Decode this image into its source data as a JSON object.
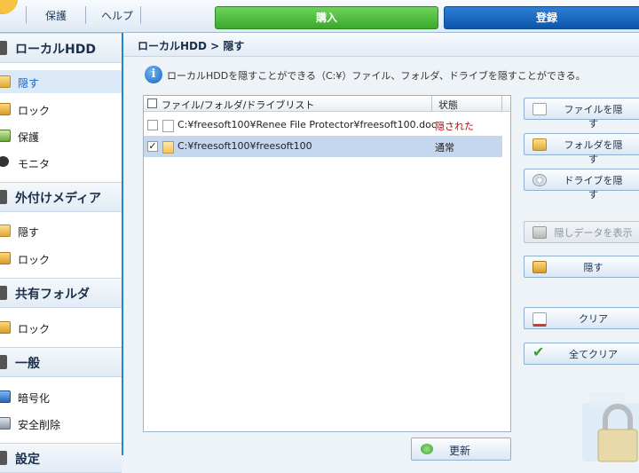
{
  "topbar": {
    "protect_label": "保護",
    "help_label": "ヘルプ",
    "buy_label": "購入",
    "register_label": "登録"
  },
  "sidebar": {
    "sections": [
      {
        "title": "ローカルHDD",
        "items": [
          "隠す",
          "ロック",
          "保護",
          "モニタ"
        ]
      },
      {
        "title": "外付けメディア",
        "items": [
          "隠す",
          "ロック"
        ]
      },
      {
        "title": "共有フォルダ",
        "items": [
          "ロック"
        ]
      },
      {
        "title": "一般",
        "items": [
          "暗号化",
          "安全削除"
        ]
      },
      {
        "title": "設定",
        "items": []
      }
    ]
  },
  "breadcrumb": "ローカルHDD > 隠す",
  "info_text": "ローカルHDDを隠すことができる（C:¥）ファイル、フォルダ、ドライブを隠すことができる。",
  "list": {
    "col_name": "ファイル/フォルダ/ドライブリスト",
    "col_status": "状態",
    "rows": [
      {
        "path": "C:¥freesoft100¥Renee File Protector¥freesoft100.doc",
        "status": "隠された",
        "checked": false,
        "type": "file"
      },
      {
        "path": "C:¥freesoft100¥freesoft100",
        "status": "通常",
        "checked": true,
        "type": "folder"
      }
    ]
  },
  "buttons": {
    "hide_file": "ファイルを隠す",
    "hide_folder": "フォルダを隠す",
    "hide_drive": "ドライブを隠す",
    "show_hidden": "隠しデータを表示",
    "hide": "隠す",
    "clear": "クリア",
    "clear_all": "全てクリア",
    "refresh": "更新"
  },
  "colors": {
    "accent_blue": "#1f86d8",
    "buy_green": "#3aa92c",
    "register_blue": "#0e55ab",
    "status_hidden": "#cc0000",
    "selected_row": "#c5d7ee"
  }
}
